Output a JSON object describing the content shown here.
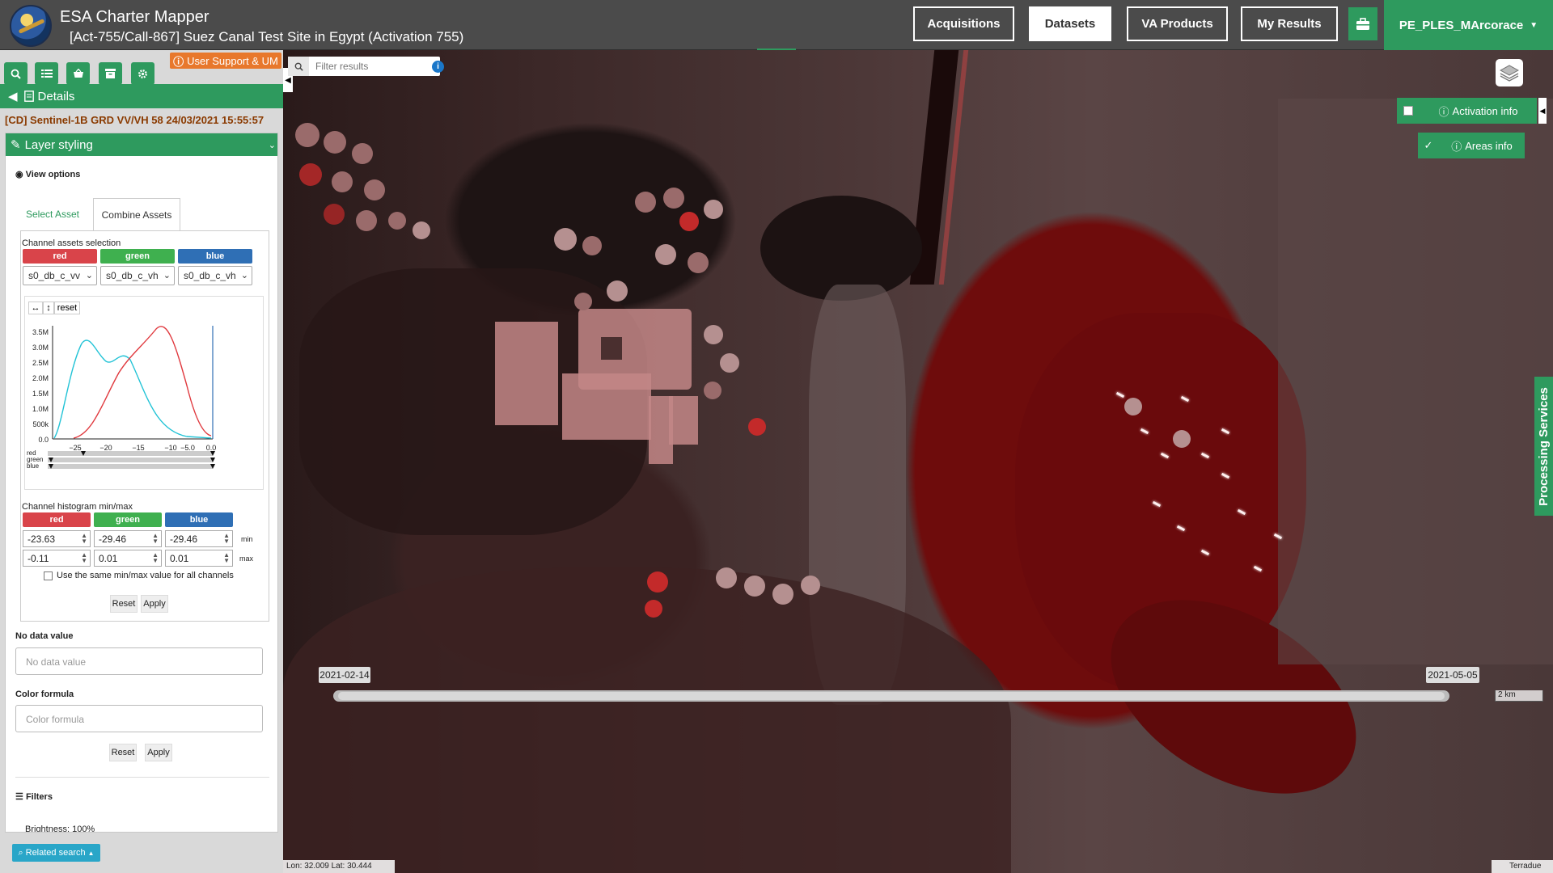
{
  "header": {
    "app_title": "ESA Charter Mapper",
    "activation_title": "[Act-755/Call-867] Suez Canal Test Site in Egypt (Activation 755)",
    "nav": [
      "Acquisitions",
      "Datasets",
      "VA Products",
      "My Results"
    ],
    "active_nav": "Datasets",
    "user": "PE_PLES_MArcorace"
  },
  "sidebar": {
    "support_label": "User Support & UM",
    "details_label": "Details",
    "dataset_title": "[CD] Sentinel-1B GRD VV/VH 58 24/03/2021 15:55:57",
    "layer_styling_label": "Layer styling",
    "view_options_label": "View options",
    "tabs": {
      "select": "Select Asset",
      "combine": "Combine Assets"
    },
    "channel_selection_label": "Channel assets selection",
    "channels": {
      "red": "red",
      "green": "green",
      "blue": "blue"
    },
    "channel_values": {
      "red": "s0_db_c_vv",
      "green": "s0_db_c_vh",
      "blue": "s0_db_c_vh"
    },
    "histogram": {
      "reset_label": "reset",
      "y_ticks": [
        "3.5M",
        "3.0M",
        "2.5M",
        "2.0M",
        "1.5M",
        "1.0M",
        "500k",
        "0.0"
      ],
      "x_ticks": [
        "−25",
        "−20",
        "−15",
        "−10",
        "−5.0",
        "0.0"
      ],
      "slider_labels": [
        "red",
        "green",
        "blue"
      ],
      "colors": {
        "red": "#e0393e",
        "cyan": "#22c3d6"
      }
    },
    "minmax_label": "Channel histogram min/max",
    "min_label": "min",
    "max_label": "max",
    "min_values": {
      "red": "-23.63",
      "green": "-29.46",
      "blue": "-29.46"
    },
    "max_values": {
      "red": "-0.11",
      "green": "0.01",
      "blue": "0.01"
    },
    "same_minmax_label": "Use the same min/max value for all channels",
    "reset_label": "Reset",
    "apply_label": "Apply",
    "no_data_label": "No data value",
    "no_data_placeholder": "No data value",
    "color_formula_label": "Color formula",
    "color_formula_placeholder": "Color formula",
    "filters_label": "Filters",
    "brightness_label": "Brightness: 100%",
    "related_search_label": "Related search"
  },
  "map": {
    "filter_placeholder": "Filter results",
    "activation_info_label": "Activation info",
    "areas_info_label": "Areas info",
    "processing_label": "Processing Services",
    "date_start": "2021-02-14",
    "date_end": "2021-05-05",
    "scale_label": "2 km",
    "coords": "Lon: 32.009 Lat: 30.444",
    "attribution": "Terradue"
  },
  "colors": {
    "accent_green": "#2e9a5e",
    "support_orange": "#e8782c",
    "related_blue": "#29a6c8"
  }
}
